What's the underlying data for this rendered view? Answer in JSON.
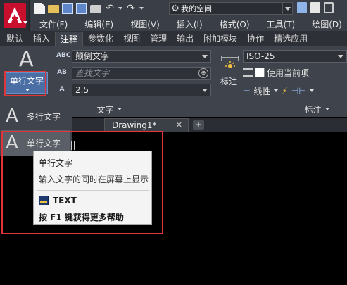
{
  "titlebar": {
    "workspace_label": "我的空间",
    "icons": [
      "new-icon",
      "open-icon",
      "save-icon",
      "saveas-icon",
      "print-icon",
      "undo-icon",
      "redo-icon"
    ]
  },
  "menubar": {
    "items": [
      "文件(F)",
      "编辑(E)",
      "视图(V)",
      "插入(I)",
      "格式(O)",
      "工具(T)",
      "绘图(D)"
    ]
  },
  "ribbon_tabs": {
    "items": [
      "默认",
      "插入",
      "注释",
      "参数化",
      "视图",
      "管理",
      "输出",
      "附加模块",
      "协作",
      "精选应用"
    ],
    "active_index": 2
  },
  "text_panel": {
    "big_icon": "A",
    "selected_button_label": "单行文字",
    "style_label_icon": "ABC",
    "style_value": "颠倒文字",
    "search_placeholder": "查找文字",
    "height_value": "2.5",
    "footer": "文字"
  },
  "annotation_panel": {
    "dim_style": "ISO-25",
    "layer_label": "使用当前项",
    "linear_label": "线性",
    "mark_label": "标注",
    "footer": "标注"
  },
  "dropdown": {
    "items": [
      {
        "icon": "A",
        "label": "多行文字"
      },
      {
        "icon": "A",
        "label": "单行文字"
      }
    ]
  },
  "doc_tabs": {
    "active": "Drawing1*",
    "close": "✕",
    "new": "+"
  },
  "tooltip": {
    "title": "单行文字",
    "description": "输入文字的同时在屏幕上显示",
    "command": "TEXT",
    "help": "按 F1 键获得更多帮助"
  },
  "colors": {
    "accent_red": "#e0353a",
    "selected_blue": "#4b6fa5",
    "ribbon_bg": "#3f434b"
  }
}
